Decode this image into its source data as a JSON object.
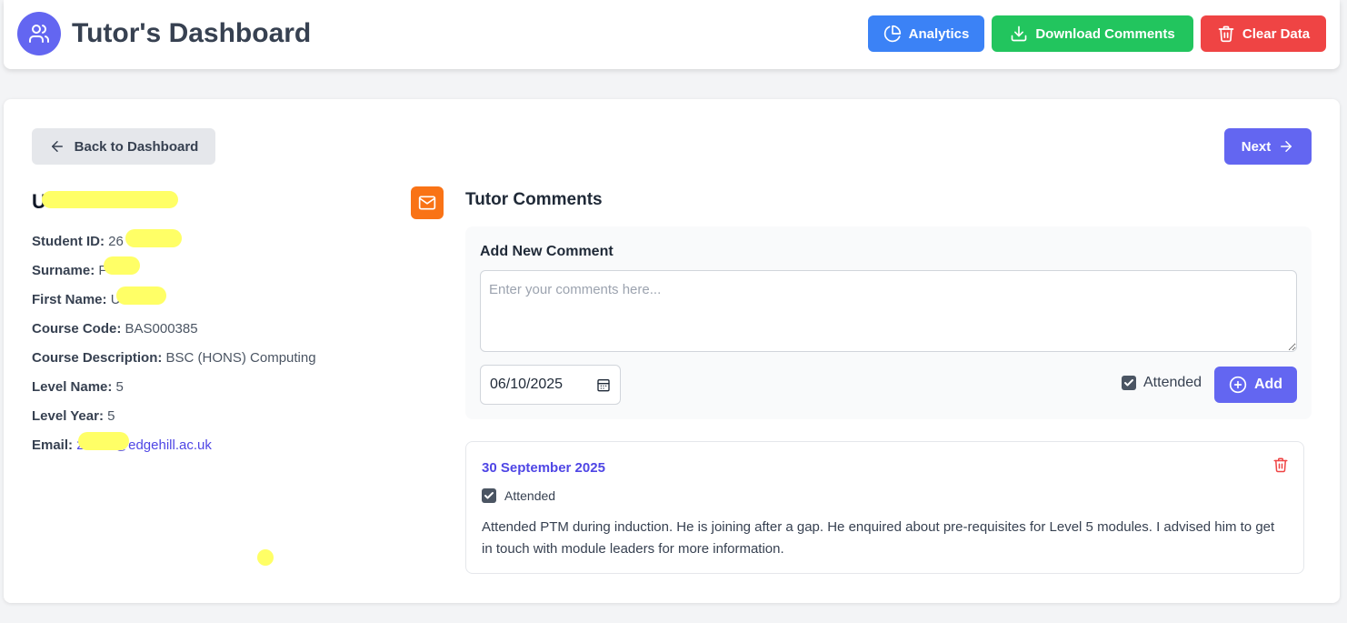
{
  "header": {
    "title": "Tutor's Dashboard",
    "buttons": {
      "analytics": "Analytics",
      "download": "Download Comments",
      "clear": "Clear Data"
    }
  },
  "nav": {
    "back": "Back to Dashboard",
    "next": "Next"
  },
  "student": {
    "name": "U",
    "fields": [
      {
        "label": "Student ID:",
        "value": "26"
      },
      {
        "label": "Surname:",
        "value": "F"
      },
      {
        "label": "First Name:",
        "value": "U"
      },
      {
        "label": "Course Code:",
        "value": "BAS000385"
      },
      {
        "label": "Course Description:",
        "value": "BSC (HONS) Computing"
      },
      {
        "label": "Level Name:",
        "value": "5"
      },
      {
        "label": "Level Year:",
        "value": "5"
      }
    ],
    "email_label": "Email:",
    "email_value": "2      6@edgehill.ac.uk"
  },
  "comments": {
    "title": "Tutor Comments",
    "add_title": "Add New Comment",
    "placeholder": "Enter your comments here...",
    "date_value": "06/10/2025",
    "attended_label": "Attended",
    "add_button": "Add",
    "items": [
      {
        "date": "30 September 2025",
        "attended_label": "Attended",
        "text": "Attended PTM during induction.  He is joining after a gap. He enquired about pre-requisites for Level 5 modules. I advised him to get in touch with module leaders for more information."
      }
    ]
  },
  "colors": {
    "primary": "#6366f1",
    "analytics": "#3b82f6",
    "download": "#22c55e",
    "clear": "#ef4444",
    "mail": "#f97316",
    "redaction": "#ffff66"
  }
}
